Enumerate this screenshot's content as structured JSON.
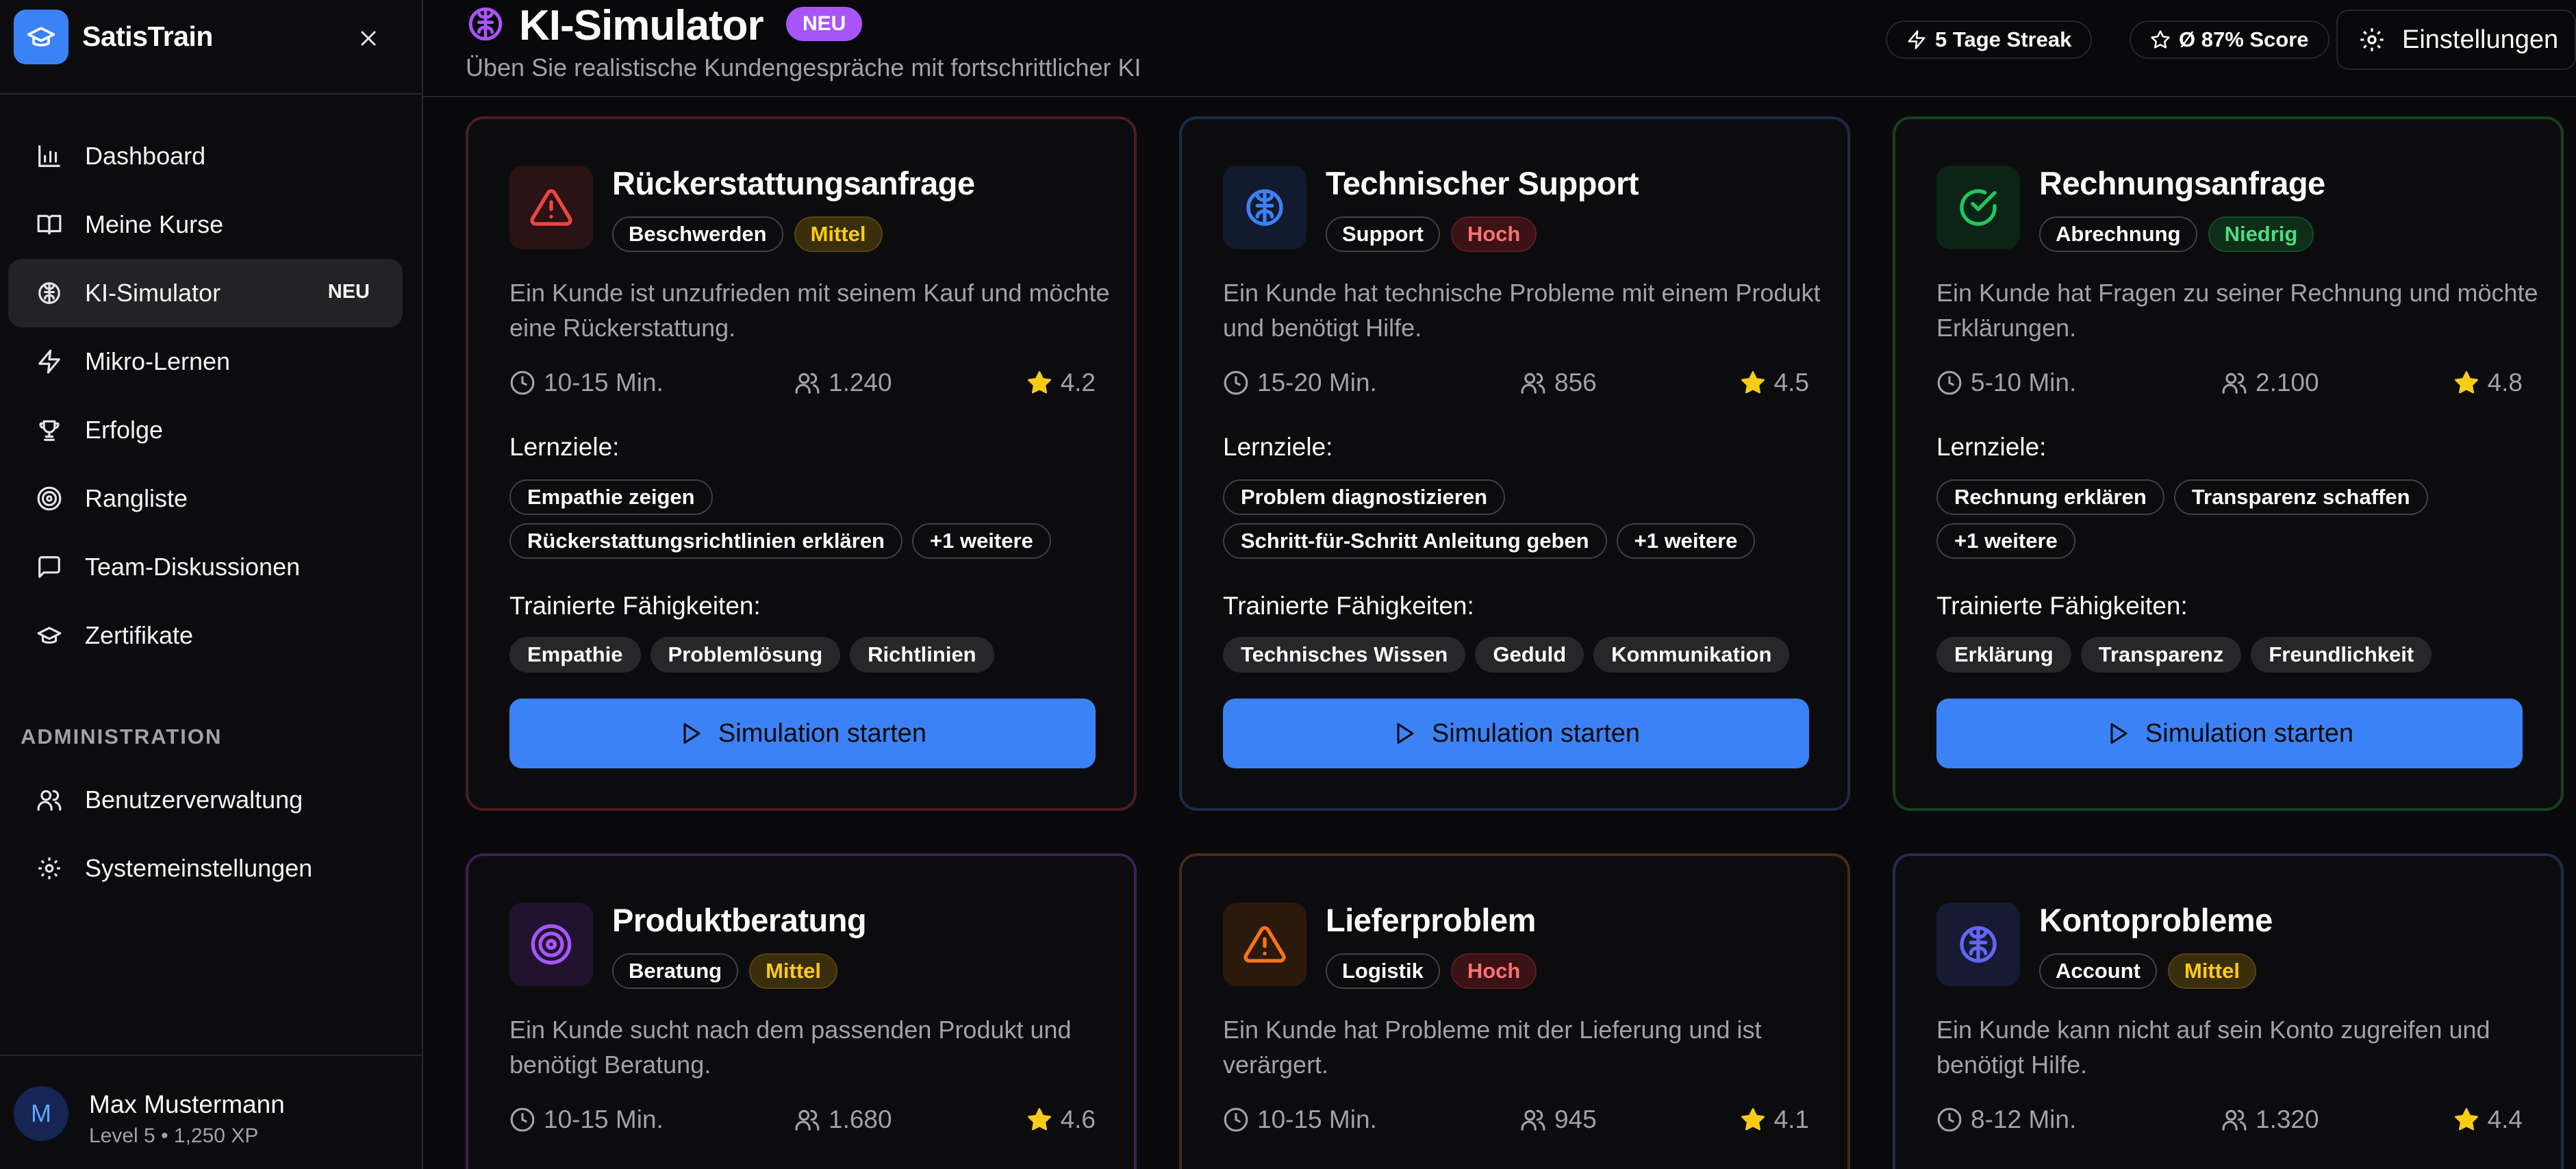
{
  "app": {
    "name": "SatisTrain"
  },
  "nav": {
    "items": [
      {
        "label": "Dashboard",
        "icon": "bar-chart-icon"
      },
      {
        "label": "Meine Kurse",
        "icon": "book-icon"
      },
      {
        "label": "KI-Simulator",
        "icon": "brain-icon",
        "badge": "NEU",
        "active": true
      },
      {
        "label": "Mikro-Lernen",
        "icon": "zap-icon"
      },
      {
        "label": "Erfolge",
        "icon": "trophy-icon"
      },
      {
        "label": "Rangliste",
        "icon": "target-icon"
      },
      {
        "label": "Team-Diskussionen",
        "icon": "message-icon"
      },
      {
        "label": "Zertifikate",
        "icon": "graduation-cap-icon"
      }
    ],
    "admin_title": "ADMINISTRATION",
    "admin_items": [
      {
        "label": "Benutzerverwaltung",
        "icon": "users-icon"
      },
      {
        "label": "Systemeinstellungen",
        "icon": "gear-icon"
      }
    ]
  },
  "user": {
    "initial": "M",
    "name": "Max Mustermann",
    "meta": "Level 5 • 1,250 XP"
  },
  "header": {
    "title": "KI-Simulator",
    "badge": "NEU",
    "subtitle": "Üben Sie realistische Kundengespräche mit fortschrittlicher KI",
    "streak": "5 Tage Streak",
    "score": "Ø 87% Score",
    "settings": "Einstellungen"
  },
  "labels": {
    "goals": "Lernziele:",
    "skills": "Trainierte Fähigkeiten:",
    "start": "Simulation starten"
  },
  "colors": {
    "accent": "#3b82f6",
    "badge_purple": "#a855f7",
    "star": "#facc15"
  },
  "cards": [
    {
      "title": "Rückerstattungsanfrage",
      "category": "Beschwerden",
      "level": "Mittel",
      "desc": "Ein Kunde ist unzufrieden mit seinem Kauf und möchte eine Rückerstattung.",
      "duration": "10-15 Min.",
      "users": "1.240",
      "rating": "4.2",
      "goals": [
        "Empathie zeigen",
        "Rückerstattungsrichtlinien erklären",
        "+1 weitere"
      ],
      "skills": [
        "Empathie",
        "Problemlösung",
        "Richtlinien"
      ],
      "icon": "alert-triangle-icon"
    },
    {
      "title": "Technischer Support",
      "category": "Support",
      "level": "Hoch",
      "desc": "Ein Kunde hat technische Probleme mit einem Produkt und benötigt Hilfe.",
      "duration": "15-20 Min.",
      "users": "856",
      "rating": "4.5",
      "goals": [
        "Problem diagnostizieren",
        "Schritt-für-Schritt Anleitung geben",
        "+1 weitere"
      ],
      "skills": [
        "Technisches Wissen",
        "Geduld",
        "Kommunikation"
      ],
      "icon": "brain-icon"
    },
    {
      "title": "Rechnungsanfrage",
      "category": "Abrechnung",
      "level": "Niedrig",
      "desc": "Ein Kunde hat Fragen zu seiner Rechnung und möchte Erklärungen.",
      "duration": "5-10 Min.",
      "users": "2.100",
      "rating": "4.8",
      "goals": [
        "Rechnung erklären",
        "Transparenz schaffen",
        "+1 weitere"
      ],
      "skills": [
        "Erklärung",
        "Transparenz",
        "Freundlichkeit"
      ],
      "icon": "check-circle-icon"
    },
    {
      "title": "Produktberatung",
      "category": "Beratung",
      "level": "Mittel",
      "desc": "Ein Kunde sucht nach dem passenden Produkt und benötigt Beratung.",
      "duration": "10-15 Min.",
      "users": "1.680",
      "rating": "4.6",
      "icon": "target-icon"
    },
    {
      "title": "Lieferproblem",
      "category": "Logistik",
      "level": "Hoch",
      "desc": "Ein Kunde hat Probleme mit der Lieferung und ist verärgert.",
      "duration": "10-15 Min.",
      "users": "945",
      "rating": "4.1",
      "icon": "alert-triangle-icon"
    },
    {
      "title": "Kontoprobleme",
      "category": "Account",
      "level": "Mittel",
      "desc": "Ein Kunde kann nicht auf sein Konto zugreifen und benötigt Hilfe.",
      "duration": "8-12 Min.",
      "users": "1.320",
      "rating": "4.4",
      "icon": "brain-icon"
    }
  ]
}
